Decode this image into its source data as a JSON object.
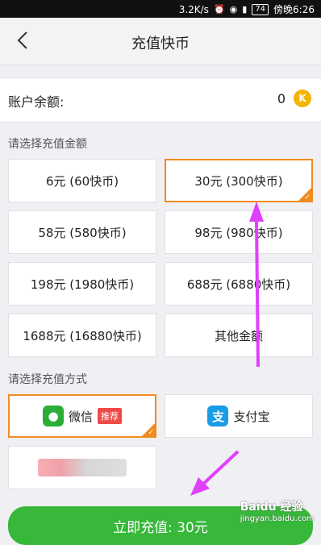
{
  "status_bar": {
    "speed": "3.2K/s",
    "battery": "74",
    "time": "傍晚6:26"
  },
  "header": {
    "title": "充值快币"
  },
  "balance": {
    "label": "账户余额:",
    "value": "0",
    "coin_icon": "K"
  },
  "amount_section": {
    "title": "请选择充值金额",
    "options": [
      {
        "label": "6元 (60快币)",
        "selected": false
      },
      {
        "label": "30元 (300快币)",
        "selected": true
      },
      {
        "label": "58元 (580快币)",
        "selected": false
      },
      {
        "label": "98元 (980快币)",
        "selected": false
      },
      {
        "label": "198元 (1980快币)",
        "selected": false
      },
      {
        "label": "688元 (6880快币)",
        "selected": false
      },
      {
        "label": "1688元 (16880快币)",
        "selected": false
      },
      {
        "label": "其他金额",
        "selected": false
      }
    ]
  },
  "method_section": {
    "title": "请选择充值方式",
    "methods": [
      {
        "label": "微信",
        "tag": "推荐",
        "icon": "wechat-icon",
        "selected": true
      },
      {
        "label": "支付宝",
        "icon": "alipay-icon",
        "selected": false
      }
    ]
  },
  "cta": {
    "label": "立即充值: 30元"
  },
  "watermark": {
    "text": "Baidu 经验",
    "sub": "jingyan.baidu.com"
  },
  "colors": {
    "accent": "#f08c1e",
    "primary_green": "#37b83a",
    "annotation_arrow": "#e040fb"
  }
}
